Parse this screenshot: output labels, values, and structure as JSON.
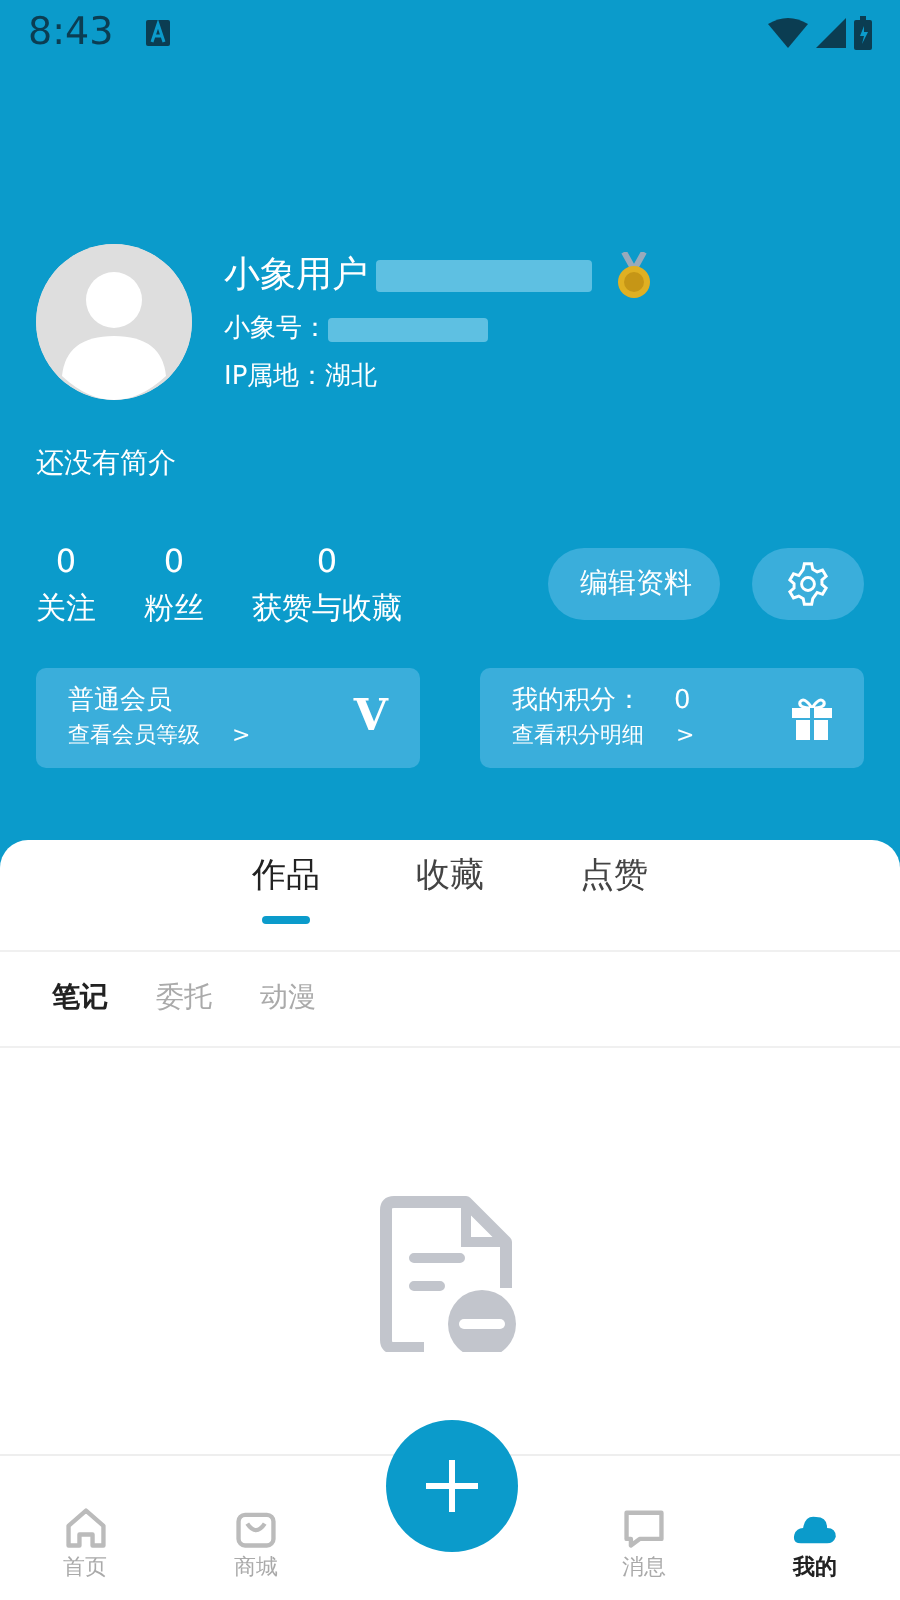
{
  "status_bar": {
    "time": "8:43"
  },
  "profile": {
    "name": "小象用户",
    "id_label": "小象号：",
    "ip_label": "IP属地：湖北",
    "bio": "还没有简介"
  },
  "stats": [
    {
      "value": "0",
      "label": "关注"
    },
    {
      "value": "0",
      "label": "粉丝"
    },
    {
      "value": "0",
      "label": "获赞与收藏"
    }
  ],
  "edit_button": "编辑资料",
  "cards": [
    {
      "kind": "vip",
      "title": "普通会员",
      "link": "查看会员等级",
      "chevron": ">",
      "mark": "V"
    },
    {
      "kind": "points",
      "title": "我的积分：",
      "value": "0",
      "link": "查看积分明细",
      "chevron": ">"
    }
  ],
  "tabs": [
    {
      "label": "作品",
      "selected": true
    },
    {
      "label": "收藏",
      "selected": false
    },
    {
      "label": "点赞",
      "selected": false
    }
  ],
  "subtabs": [
    {
      "label": "笔记",
      "selected": true
    },
    {
      "label": "委托",
      "selected": false
    },
    {
      "label": "动漫",
      "selected": false
    }
  ],
  "bottom_nav": [
    {
      "kind": "home",
      "label": "首页",
      "selected": false
    },
    {
      "kind": "shop",
      "label": "商城",
      "selected": false
    },
    {
      "kind": "add"
    },
    {
      "kind": "message",
      "label": "消息",
      "selected": false
    },
    {
      "kind": "me",
      "label": "我的",
      "selected": true
    }
  ]
}
